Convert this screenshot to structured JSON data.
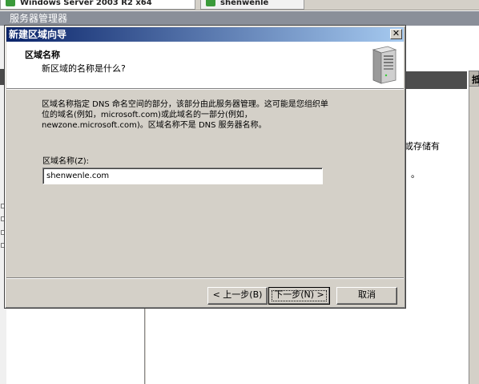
{
  "background": {
    "tabs": [
      {
        "label": "Windows Server 2003 R2 x64"
      },
      {
        "label": "shenwenle"
      }
    ],
    "window_title": "服务器管理器",
    "panel_header": "抵",
    "text_fragments": [
      {
        "text": "或存储有"
      },
      {
        "text": "。"
      }
    ]
  },
  "dialog": {
    "title": "新建区域向导",
    "close_symbol": "✕",
    "header": {
      "title": "区域名称",
      "subtitle": "新区域的名称是什么?"
    },
    "description_lines": [
      "区域名称指定 DNS 命名空间的部分，该部分由此服务器管理。这可能是您组织单",
      "位的域名(例如，microsoft.com)或此域名的一部分(例如，",
      "newzone.microsoft.com)。区域名称不是 DNS 服务器名称。"
    ],
    "field_label": "区域名称(Z):",
    "zone_name_value": "shenwenle.com",
    "buttons": {
      "back": "< 上一步(B)",
      "next": "下一步(N) >",
      "cancel": "取消"
    }
  },
  "colors": {
    "title_gradient_start": "#0a246a",
    "title_gradient_end": "#a6caf0",
    "dialog_face": "#d4d0c8"
  },
  "icons": [
    "server-icon",
    "close-icon"
  ]
}
